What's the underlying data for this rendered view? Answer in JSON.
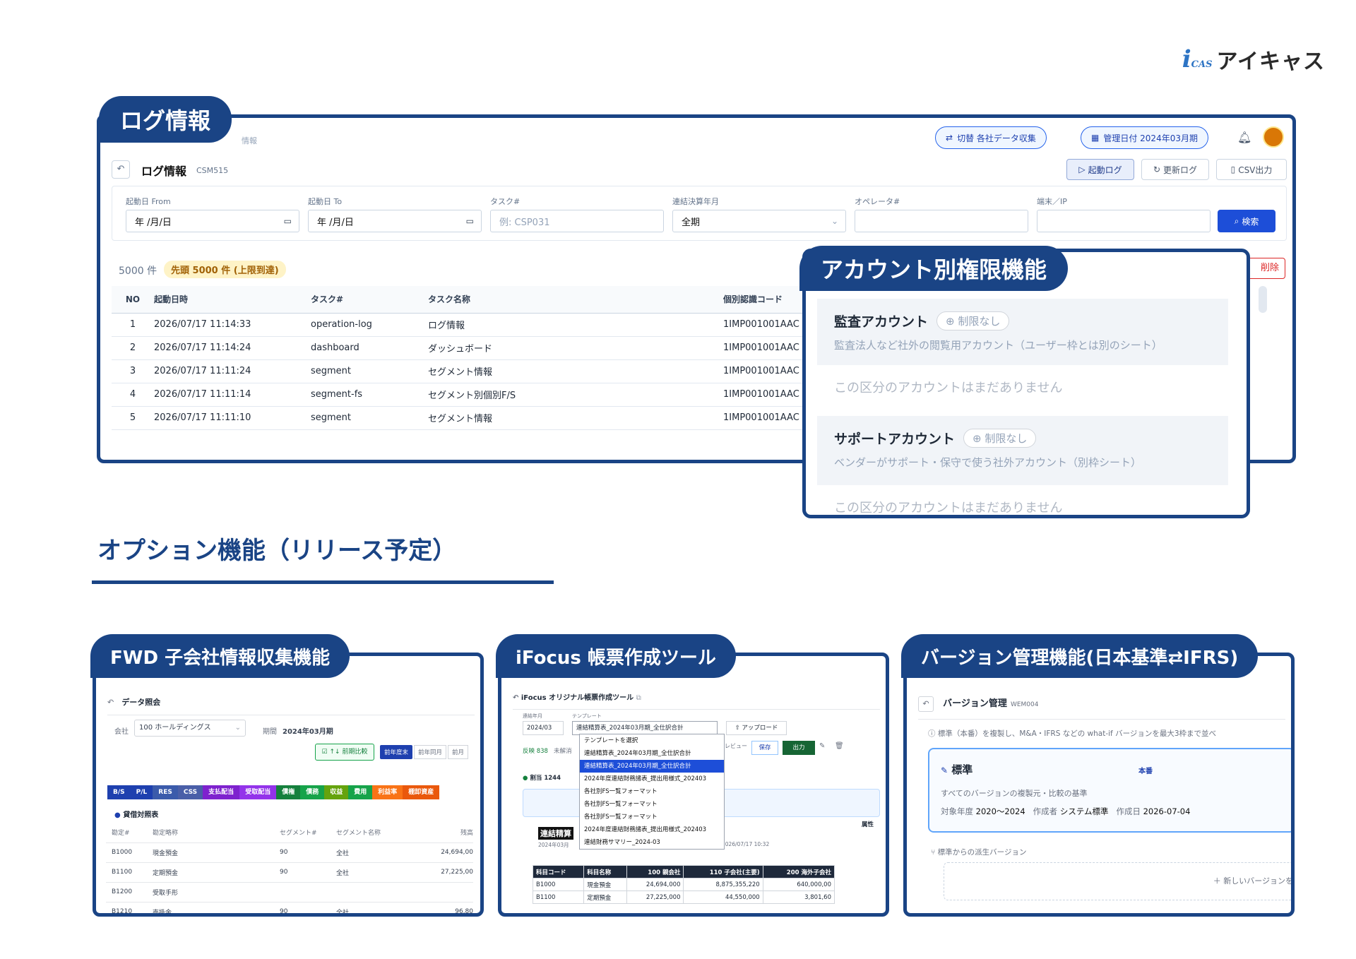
{
  "logo": {
    "mark": "i",
    "sub": "CAS",
    "text": "アイキャス"
  },
  "log_panel": {
    "tag": "ログ情報",
    "header_pill_1": "切替 各社データ収集",
    "header_pill_2": "管理日付 2024年03月期",
    "breadcrumb": "情報",
    "title": "ログ情報",
    "code": "CSM515",
    "buttons": {
      "start_log": "起動ログ",
      "update_log": "更新ログ",
      "csv": "CSV出力",
      "search": "検索",
      "delete": "削除"
    },
    "filters": {
      "from_label": "起動日 From",
      "from_value": "年 /月/日",
      "to_label": "起動日 To",
      "to_value": "年 /月/日",
      "task_label": "タスク#",
      "task_placeholder": "例: CSP031",
      "period_label": "連結決算年月",
      "period_value": "全期",
      "operator_label": "オペレータ#",
      "terminal_label": "端末／IP"
    },
    "count": "5000 件",
    "limit_badge": "先頭 5000 件 (上限到達)",
    "columns": [
      "NO",
      "起動日時",
      "タスク#",
      "タスク名称",
      "個別認識コード"
    ],
    "rows": [
      [
        "1",
        "2026/07/17 11:14:33",
        "operation-log",
        "ログ情報",
        "1IMP001001AAC"
      ],
      [
        "2",
        "2026/07/17 11:14:24",
        "dashboard",
        "ダッシュボード",
        "1IMP001001AAC"
      ],
      [
        "3",
        "2026/07/17 11:11:24",
        "segment",
        "セグメント情報",
        "1IMP001001AAC"
      ],
      [
        "4",
        "2026/07/17 11:11:14",
        "segment-fs",
        "セグメント別個別F/S",
        "1IMP001001AAC"
      ],
      [
        "5",
        "2026/07/17 11:11:10",
        "segment",
        "セグメント情報",
        "1IMP001001AAC"
      ]
    ]
  },
  "account_panel": {
    "tag": "アカウント別権限機能",
    "sections": [
      {
        "title": "監査アカウント",
        "badge": "制限なし",
        "desc": "監査法人など社外の閲覧用アカウント（ユーザー枠とは別のシート）",
        "empty": "この区分のアカウントはまだありません"
      },
      {
        "title": "サポートアカウント",
        "badge": "制限なし",
        "desc": "ベンダーがサポート・保守で使う社外アカウント（別枠シート）",
        "empty": "この区分のアカウントはまだありません"
      }
    ]
  },
  "options": {
    "title": "オプション機能（リリース予定）",
    "fwd": {
      "tag": "FWD 子会社情報収集機能",
      "title": "データ照会",
      "company_label": "会社",
      "company_value": "100 ホールディングス",
      "period_label": "期間",
      "period_value": "2024年03月期",
      "compare_btn": "↑↓ 前期比較",
      "toggles": [
        "前年度末",
        "前年同月",
        "前月"
      ],
      "tabs": [
        "B/S",
        "P/L",
        "RES",
        "CSS",
        "支払配当",
        "受取配当",
        "債権",
        "債務",
        "収益",
        "費用",
        "利益率",
        "棚卸資産"
      ],
      "tab_colors": [
        "#1e40af",
        "#1e40af",
        "#3b5bab",
        "#4a5fa8",
        "#7e22ce",
        "#9333ea",
        "#15803d",
        "#16a34a",
        "#65a30d",
        "#16a34a",
        "#f97316",
        "#ea580c"
      ],
      "section": "貸借対照表",
      "columns": [
        "勘定#",
        "勘定略称",
        "セグメント#",
        "セグメント名称",
        "残高"
      ],
      "rows": [
        [
          "B1000",
          "現金預金",
          "90",
          "全社",
          "24,694,00"
        ],
        [
          "B1100",
          "定期預金",
          "90",
          "全社",
          "27,225,00"
        ],
        [
          "B1200",
          "受取手形",
          "",
          "",
          ""
        ],
        [
          "B1210",
          "売掛金",
          "90",
          "全社",
          "96,80"
        ]
      ]
    },
    "ifocus": {
      "tag": "iFocus 帳票作成ツール",
      "title": "iFocus オリジナル帳票作成ツール",
      "period_label": "連結年月",
      "period_value": "2024/03",
      "template_label": "テンプレート",
      "template_value": "連結精算表_2024年03月期_全仕訳合計",
      "upload": "アップロード",
      "status_1": "反映 838",
      "status_2": "未解消",
      "review": "レビュー",
      "save": "保存",
      "export": "出力",
      "assign": "割当 1244",
      "dropdown": [
        "テンプレートを選択",
        "連結精算表_2024年03月期_全仕訳合計",
        "連結精算表_2024年03月期_全仕訳合計",
        "2024年度連結財務諸表_提出用様式_202403",
        "各社別FS一覧フォーマット",
        "各社別FS一覧フォーマット",
        "各社別FS一覧フォーマット",
        "2024年度連結財務諸表_提出用様式_202403",
        "連結財務サマリー_2024-03"
      ],
      "sheet_title": "連結精算",
      "sheet_date": "2024年03月",
      "sheet_date2": "2026/07/17 10:32",
      "attr": "属性",
      "grid_header": [
        "科目コード",
        "科目名称",
        "100 親会社",
        "110 子会社(主要)",
        "200 海外子会社"
      ],
      "grid_rows": [
        [
          "B1000",
          "現金預金",
          "24,694,000",
          "8,875,355,220",
          "640,000,00"
        ],
        [
          "B1100",
          "定期預金",
          "27,225,000",
          "44,550,000",
          "3,801,60"
        ]
      ]
    },
    "version": {
      "tag": "バージョン管理機能(日本基準⇄IFRS)",
      "title": "バージョン管理",
      "code": "WEM004",
      "info": "標準（本番）を複製し、M&A・IFRS などの what-if バージョンを最大3枠まで並べ",
      "card_title": "標準",
      "card_badge": "本番",
      "card_desc": "すべてのバージョンの複製元・比較の基準",
      "year_label": "対象年度",
      "year_value": "2020〜2024",
      "creator_label": "作成者",
      "creator_value": "システム標準",
      "date_label": "作成日",
      "date_value": "2026-07-04",
      "derived": "標準からの派生バージョン",
      "new_btn": "＋ 新しいバージョンを"
    }
  }
}
